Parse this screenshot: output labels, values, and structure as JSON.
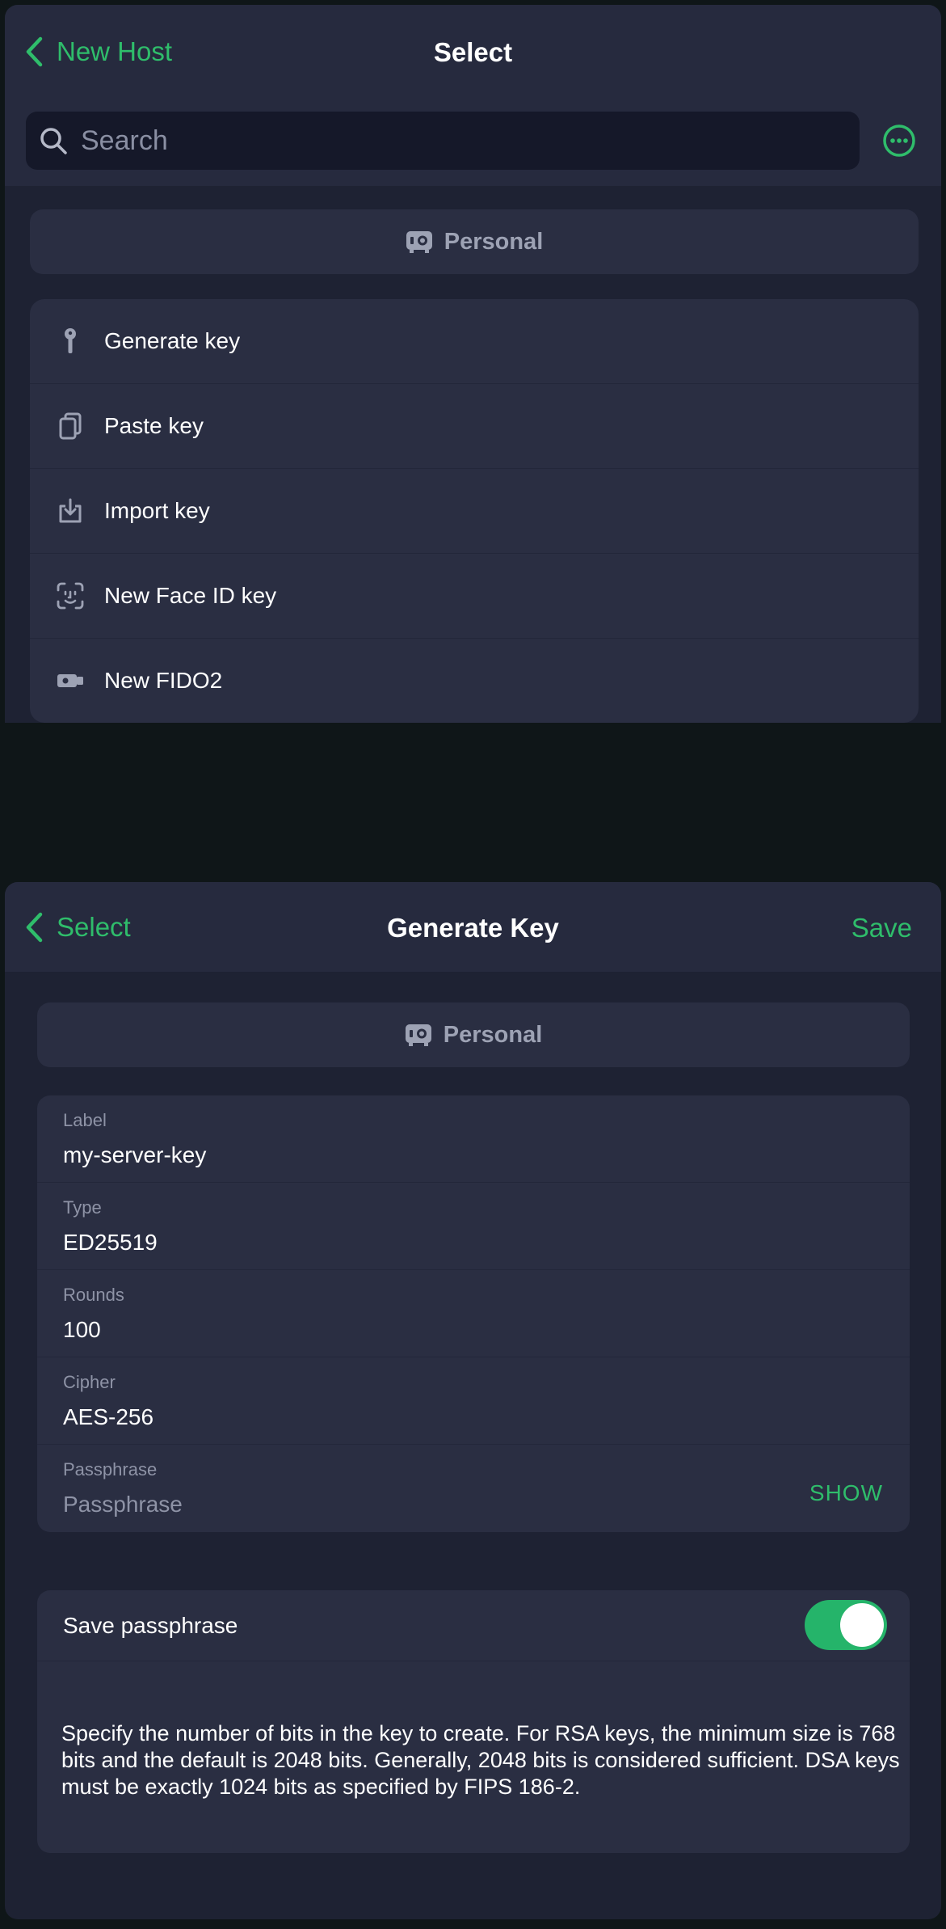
{
  "select_screen": {
    "back_label": "New Host",
    "title": "Select",
    "search": {
      "placeholder": "Search"
    },
    "vault_label": "Personal",
    "items": [
      {
        "label": "Generate key",
        "icon": "key-icon"
      },
      {
        "label": "Paste key",
        "icon": "clipboard-icon"
      },
      {
        "label": "Import key",
        "icon": "import-icon"
      },
      {
        "label": "New Face ID key",
        "icon": "face-id-icon"
      },
      {
        "label": "New FIDO2",
        "icon": "security-key-icon"
      }
    ]
  },
  "generate_screen": {
    "back_label": "Select",
    "title": "Generate Key",
    "save_label": "Save",
    "vault_label": "Personal",
    "fields": {
      "label": {
        "label": "Label",
        "value": "my-server-key"
      },
      "type": {
        "label": "Type",
        "value": "ED25519"
      },
      "rounds": {
        "label": "Rounds",
        "value": "100"
      },
      "cipher": {
        "label": "Cipher",
        "value": "AES-256"
      },
      "passphrase": {
        "label": "Passphrase",
        "placeholder": "Passphrase",
        "show_label": "SHOW"
      }
    },
    "save_passphrase": {
      "label": "Save passphrase",
      "enabled": true
    },
    "description": "Specify the number of bits in the key to create. For RSA keys, the minimum size is 768 bits and the default is 2048 bits. Generally, 2048 bits is considered sufficient. DSA keys must be exactly 1024 bits as specified by FIPS 186-2."
  },
  "colors": {
    "accent": "#2fbd6b",
    "background": "#1e2233",
    "card": "#2a2e42",
    "toggle_on": "#25b46a"
  }
}
